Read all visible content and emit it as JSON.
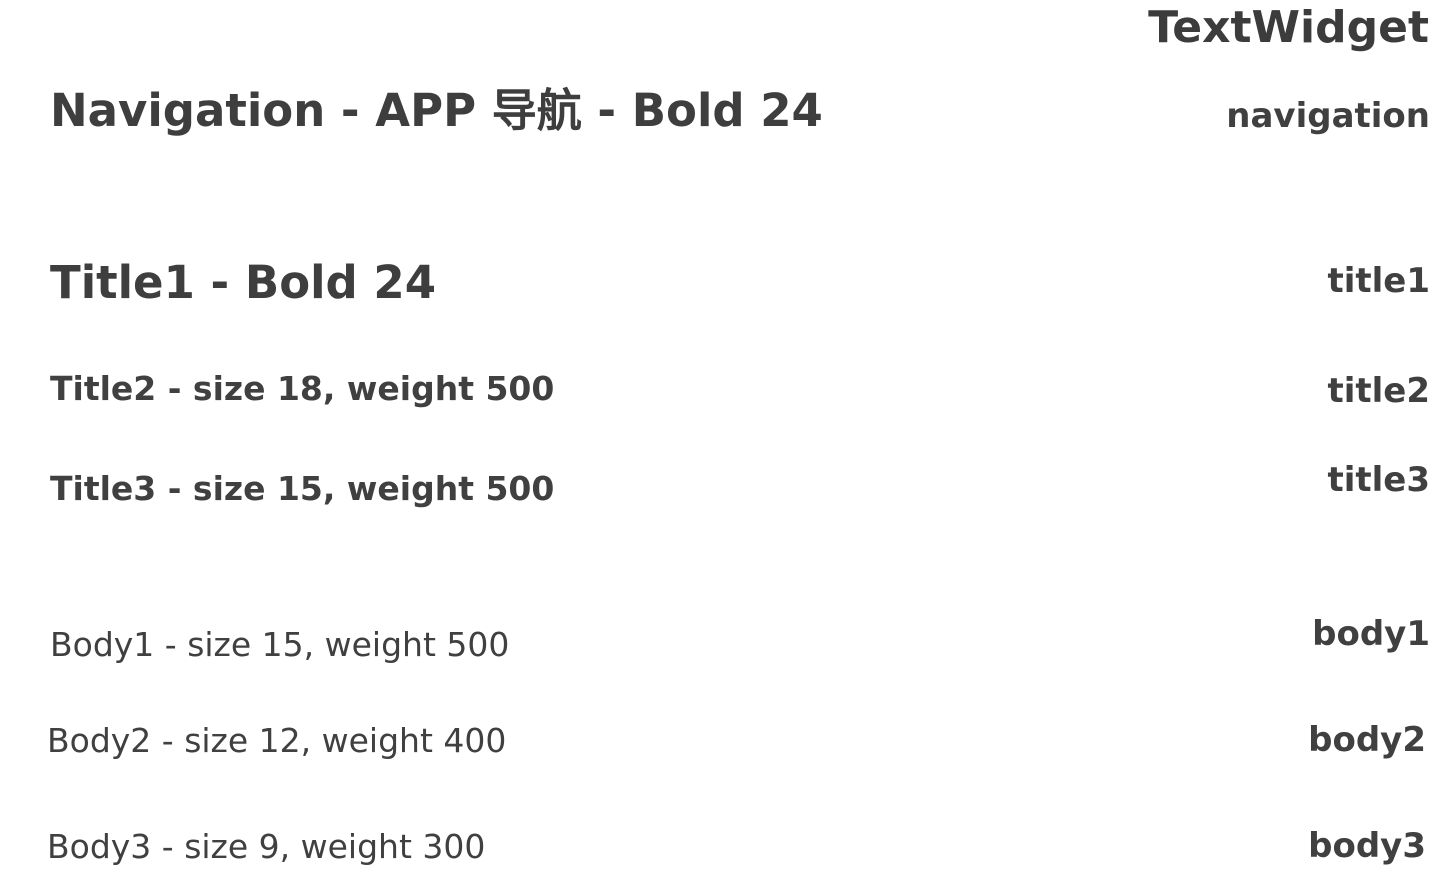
{
  "header": {
    "title": "TextWidget"
  },
  "styles": [
    {
      "label": "Navigation - APP 导航 - Bold 24",
      "code": "navigation"
    },
    {
      "label": "Title1 - Bold 24",
      "code": "title1"
    },
    {
      "label": "Title2 - size 18, weight 500",
      "code": "title2"
    },
    {
      "label": "Title3 - size 15, weight 500",
      "code": "title3"
    },
    {
      "label": "Body1 - size 15, weight 500",
      "code": "body1"
    },
    {
      "label": "Body2 - size 12, weight 400",
      "code": "body2"
    },
    {
      "label": "Body3 - size 9, weight 300",
      "code": "body3"
    }
  ],
  "colors": {
    "text": "#404040",
    "background": "#ffffff"
  }
}
